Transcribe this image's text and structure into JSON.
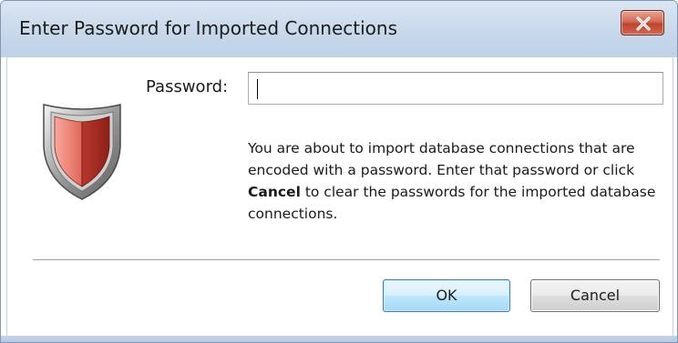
{
  "window": {
    "title": "Enter Password for Imported Connections",
    "close_icon": "close-icon"
  },
  "form": {
    "password_label": "Password:",
    "password_value": "",
    "shield_icon": "security-shield-icon"
  },
  "message": {
    "part1": "You are about to import database connections that are encoded with a password. Enter that password or click ",
    "bold": "Cancel",
    "part2": " to clear the passwords for the imported database connections."
  },
  "buttons": {
    "ok_label": "OK",
    "cancel_label": "Cancel"
  },
  "colors": {
    "titlebar": "#cbdaec",
    "close_button": "#c7503a",
    "shield_red": "#d9564a",
    "default_button_border": "#3c7fb1"
  }
}
